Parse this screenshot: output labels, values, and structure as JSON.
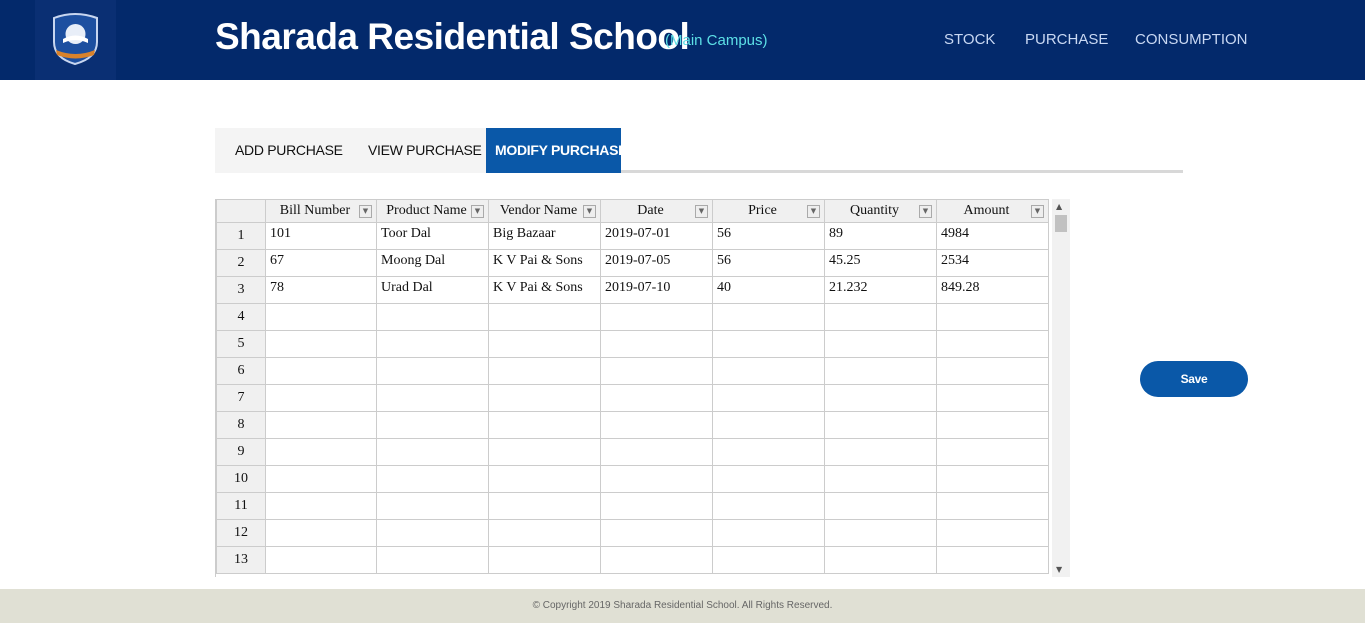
{
  "header": {
    "title": "Sharada Residential School",
    "campus": "(Main Campus)",
    "logo_icon": "school-crest-icon",
    "nav": {
      "stock": "STOCK",
      "purchase": "PURCHASE",
      "consumption": "CONSUMPTION"
    }
  },
  "tabs": {
    "add": "ADD PURCHASE",
    "view": "VIEW PURCHASE",
    "modify": "MODIFY PURCHASE",
    "active": "modify"
  },
  "grid": {
    "columns": [
      "Bill Number",
      "Product Name",
      "Vendor Name",
      "Date",
      "Price",
      "Quantity",
      "Amount"
    ],
    "column_dropdown_icon": "dropdown-arrow-icon",
    "rows": [
      [
        "101",
        "Toor Dal",
        "Big Bazaar",
        "2019-07-01",
        "56",
        "89",
        "4984"
      ],
      [
        "67",
        "Moong Dal",
        "K V Pai & Sons",
        "2019-07-05",
        "56",
        "45.25",
        "2534"
      ],
      [
        "78",
        "Urad Dal",
        "K V Pai & Sons",
        "2019-07-10",
        "40",
        "21.232",
        "849.28"
      ],
      [
        "",
        "",
        "",
        "",
        "",
        "",
        ""
      ],
      [
        "",
        "",
        "",
        "",
        "",
        "",
        ""
      ],
      [
        "",
        "",
        "",
        "",
        "",
        "",
        ""
      ],
      [
        "",
        "",
        "",
        "",
        "",
        "",
        ""
      ],
      [
        "",
        "",
        "",
        "",
        "",
        "",
        ""
      ],
      [
        "",
        "",
        "",
        "",
        "",
        "",
        ""
      ],
      [
        "",
        "",
        "",
        "",
        "",
        "",
        ""
      ],
      [
        "",
        "",
        "",
        "",
        "",
        "",
        ""
      ],
      [
        "",
        "",
        "",
        "",
        "",
        "",
        ""
      ],
      [
        "",
        "",
        "",
        "",
        "",
        "",
        ""
      ]
    ],
    "row_numbers": [
      "1",
      "2",
      "3",
      "4",
      "5",
      "6",
      "7",
      "8",
      "9",
      "10",
      "11",
      "12",
      "13"
    ]
  },
  "actions": {
    "save_label": "Save"
  },
  "footer": {
    "text": "© Copyright 2019 Sharada Residential School. All Rights Reserved."
  },
  "colors": {
    "header_bg": "#03296b",
    "accent": "#0a58a8",
    "campus_text": "#5de0e6",
    "footer_bg": "#e0e0d4"
  }
}
